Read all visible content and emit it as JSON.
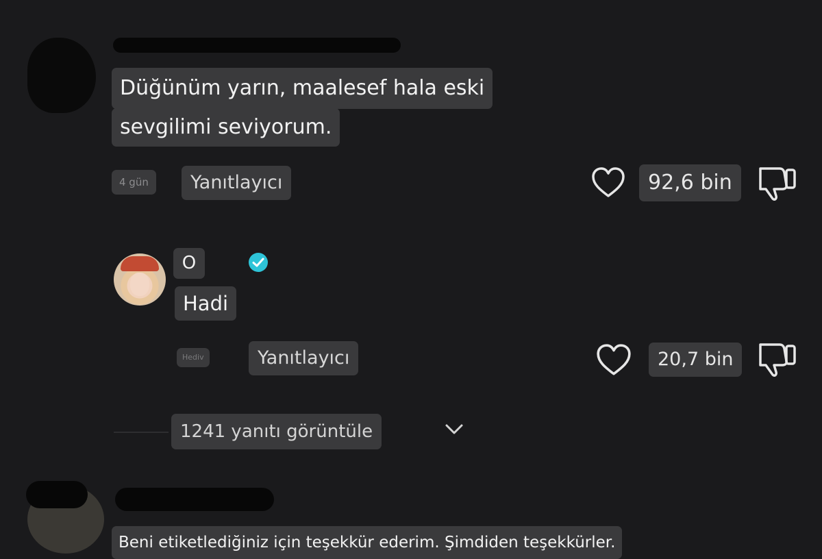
{
  "comments": [
    {
      "text_line1": "Düğünüm yarın, maalesef hala eski",
      "text_line2": "sevgilimi seviyorum.",
      "age": "4 gün",
      "reply_label": "Yanıtlayıcı",
      "likes": "92,6 bin"
    },
    {
      "username": "O",
      "verified": true,
      "text": "Hadi",
      "age": "Hediv",
      "reply_label": "Yanıtlayıcı",
      "likes": "20,7 bin"
    },
    {
      "text": "Beni etiketlediğiniz için teşekkür ederim. Şimdiden teşekkürler."
    }
  ],
  "view_replies": "1241 yanıtı görüntüle",
  "colors": {
    "background": "#1a1a1c",
    "chip": "#3a3a3c",
    "verified": "#2ec4d8"
  },
  "icons": {
    "like": "heart-icon",
    "dislike": "thumbs-down-icon",
    "expand": "chevron-down-icon",
    "verified": "verified-badge-icon"
  }
}
